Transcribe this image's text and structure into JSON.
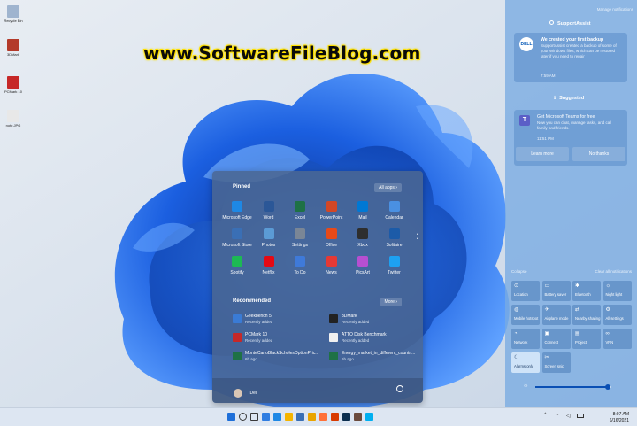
{
  "watermark": "www.SoftwareFileBlog.com",
  "desktop_icons": [
    {
      "label": "Recycle Bin",
      "color": "#9fb4cf"
    },
    {
      "label": "3DMark",
      "color": "#b33a2a"
    },
    {
      "label": "PCMark 10",
      "color": "#c62828"
    },
    {
      "label": "note.JPG",
      "color": "#e8e8e8"
    }
  ],
  "start": {
    "pinned_label": "Pinned",
    "all_apps_label": "All apps",
    "pinned": [
      {
        "label": "Microsoft Edge",
        "color": "#1e88e5"
      },
      {
        "label": "Word",
        "color": "#2b5797"
      },
      {
        "label": "Excel",
        "color": "#1e7145"
      },
      {
        "label": "PowerPoint",
        "color": "#d24726"
      },
      {
        "label": "Mail",
        "color": "#0078d4"
      },
      {
        "label": "Calendar",
        "color": "#4a90e2"
      },
      {
        "label": "Microsoft Store",
        "color": "#3a6fb5"
      },
      {
        "label": "Photos",
        "color": "#5b9bd5"
      },
      {
        "label": "Settings",
        "color": "#7a8696"
      },
      {
        "label": "Office",
        "color": "#e64a19"
      },
      {
        "label": "Xbox",
        "color": "#2e2e2e"
      },
      {
        "label": "Solitaire",
        "color": "#1c5ba8"
      },
      {
        "label": "Spotify",
        "color": "#1db954"
      },
      {
        "label": "Netflix",
        "color": "#e50914"
      },
      {
        "label": "To Do",
        "color": "#3f7ad9"
      },
      {
        "label": "News",
        "color": "#e53935"
      },
      {
        "label": "PicsArt",
        "color": "#b74fd1"
      },
      {
        "label": "Twitter",
        "color": "#1da1f2"
      }
    ],
    "recommended_label": "Recommended",
    "more_label": "More",
    "recommended": [
      {
        "name": "Geekbench 5",
        "sub": "Recently added",
        "color": "#3a7bd5"
      },
      {
        "name": "3DMark",
        "sub": "Recently added",
        "color": "#222222"
      },
      {
        "name": "PCMark 10",
        "sub": "Recently added",
        "color": "#c62828"
      },
      {
        "name": "ATTO Disk Benchmark",
        "sub": "Recently added",
        "color": "#f0f0f0"
      },
      {
        "name": "MonteCarloBlackScholesOptionPric...",
        "sub": "6h ago",
        "color": "#1e7145"
      },
      {
        "name": "Energy_market_in_different_countri...",
        "sub": "6h ago",
        "color": "#1e7145"
      }
    ],
    "user": "Dell"
  },
  "action_center": {
    "manage_label": "Manage notifications",
    "app1": "SupportAssist",
    "notif1_title": "We created your first backup",
    "notif1_body": "SupportAssist created a backup of some of your Windows files, which can be restored later if you need to repair",
    "notif1_time": "7:59 AM",
    "app2": "Suggested",
    "notif2_title": "Get Microsoft Teams for free",
    "notif2_body": "Now you can chat, manage tasks, and call family and friends.",
    "notif2_time": "11:51 PM",
    "learn_more": "Learn more",
    "no_thanks": "No thanks",
    "collapse": "Collapse",
    "clear_all": "Clear all notifications",
    "tiles": [
      {
        "label": "Location",
        "icon": "⊙",
        "on": false
      },
      {
        "label": "Battery saver",
        "icon": "▭",
        "on": false
      },
      {
        "label": "Bluetooth",
        "icon": "✱",
        "on": false
      },
      {
        "label": "Night light",
        "icon": "☼",
        "on": false
      },
      {
        "label": "Mobile hotspot",
        "icon": "◍",
        "on": false
      },
      {
        "label": "Airplane mode",
        "icon": "✈",
        "on": false
      },
      {
        "label": "Nearby sharing",
        "icon": "⇄",
        "on": false
      },
      {
        "label": "All settings",
        "icon": "⚙",
        "on": false
      },
      {
        "label": "Network",
        "icon": "◔",
        "on": false
      },
      {
        "label": "Connect",
        "icon": "▣",
        "on": false
      },
      {
        "label": "Project",
        "icon": "▤",
        "on": false
      },
      {
        "label": "VPN",
        "icon": "∞",
        "on": false
      },
      {
        "label": "Alarms only",
        "icon": "☾",
        "on": true
      },
      {
        "label": "Screen snip",
        "icon": "✂",
        "on": false
      }
    ],
    "brightness": 0.95
  },
  "taskbar": {
    "time": "8:07 AM",
    "date": "6/16/2021",
    "icons": [
      {
        "name": "start-icon",
        "color": "#1e6fd9"
      },
      {
        "name": "search-icon",
        "color": "#3a3a3a"
      },
      {
        "name": "task-view-icon",
        "color": "#3a3a3a"
      },
      {
        "name": "widgets-icon",
        "color": "#2f7de1"
      },
      {
        "name": "edge-icon",
        "color": "#1e88e5"
      },
      {
        "name": "explorer-icon",
        "color": "#f4b400"
      },
      {
        "name": "store-icon",
        "color": "#3a6fb5"
      },
      {
        "name": "chrome-icon",
        "color": "#e9a400"
      },
      {
        "name": "firefox-icon",
        "color": "#ff7139"
      },
      {
        "name": "office-icon",
        "color": "#d83b01"
      },
      {
        "name": "photoshop-icon",
        "color": "#0b2e4f"
      },
      {
        "name": "mail-icon",
        "color": "#6b4b3e"
      },
      {
        "name": "skype-icon",
        "color": "#00aff0"
      }
    ]
  }
}
